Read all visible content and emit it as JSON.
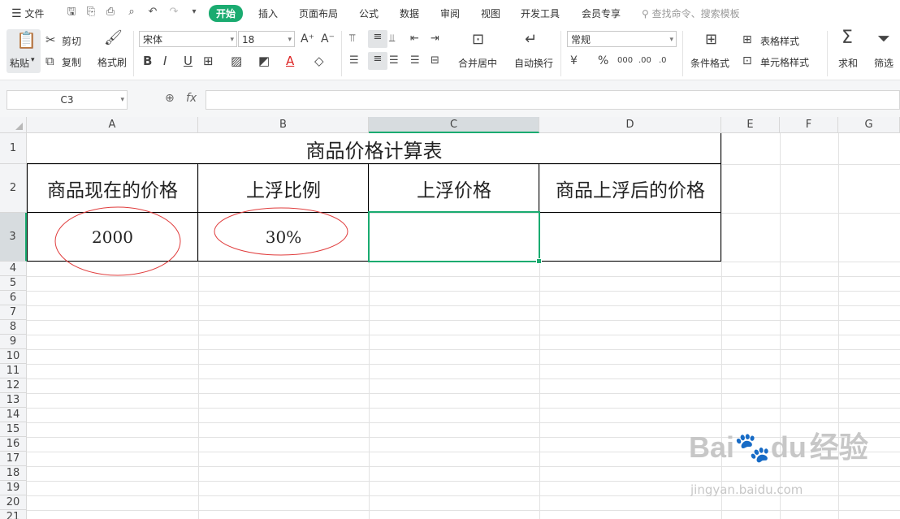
{
  "menu": {
    "file": "文件",
    "tabs": [
      "开始",
      "插入",
      "页面布局",
      "公式",
      "数据",
      "审阅",
      "视图",
      "开发工具",
      "会员专享"
    ],
    "search_placeholder": "查找命令、搜索模板"
  },
  "ribbon": {
    "paste": "粘贴",
    "cut": "剪切",
    "copy": "复制",
    "format_painter": "格式刷",
    "font_name": "宋体",
    "font_size": "18",
    "merge_center": "合并居中",
    "wrap_text": "自动换行",
    "number_format": "常规",
    "conditional_format": "条件格式",
    "table_style": "表格样式",
    "cell_style": "单元格样式",
    "sum": "求和",
    "filter": "筛选"
  },
  "formula_bar": {
    "name_box": "C3",
    "fx": "fx",
    "content": ""
  },
  "sheet": {
    "columns": [
      "A",
      "B",
      "C",
      "D",
      "E",
      "F",
      "G"
    ],
    "rows": [
      "1",
      "2",
      "3",
      "4",
      "5",
      "6",
      "7",
      "8",
      "9",
      "10",
      "11",
      "12",
      "13",
      "14",
      "15",
      "16",
      "17",
      "18",
      "19",
      "20",
      "21"
    ],
    "title": "商品价格计算表",
    "headers": [
      "商品现在的价格",
      "上浮比例",
      "上浮价格",
      "商品上浮后的价格"
    ],
    "values": [
      "2000",
      "30%",
      "",
      ""
    ],
    "selected_cell": "C3"
  },
  "watermark": {
    "brand": "Bai",
    "brand2": "du",
    "cn": "经验",
    "url": "jingyan.baidu.com"
  },
  "colors": {
    "accent": "#1aab70",
    "annotation": "#e03c3c"
  }
}
